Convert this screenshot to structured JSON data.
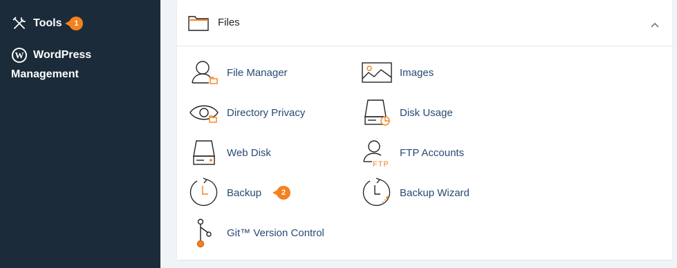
{
  "sidebar": {
    "tools_label": "Tools",
    "tools_badge": "1",
    "wordpress_label_line1": "WordPress",
    "wordpress_label_line2": "Management"
  },
  "panel": {
    "title": "Files",
    "collapse_icon": "chevron-up-icon",
    "items": [
      {
        "label": "File Manager",
        "icon": "file-manager-icon"
      },
      {
        "label": "Images",
        "icon": "images-icon"
      },
      {
        "label": "Directory Privacy",
        "icon": "directory-privacy-icon"
      },
      {
        "label": "Disk Usage",
        "icon": "disk-usage-icon"
      },
      {
        "label": "Web Disk",
        "icon": "web-disk-icon"
      },
      {
        "label": "FTP Accounts",
        "icon": "ftp-accounts-icon"
      },
      {
        "label": "Backup",
        "icon": "backup-icon",
        "badge": "2"
      },
      {
        "label": "Backup Wizard",
        "icon": "backup-wizard-icon"
      },
      {
        "label": "Git™ Version Control",
        "icon": "git-icon"
      }
    ]
  },
  "colors": {
    "sidebar_bg": "#1b2b3a",
    "accent_orange": "#f48120",
    "link_blue": "#274a73",
    "page_bg": "#f1f4f6"
  }
}
